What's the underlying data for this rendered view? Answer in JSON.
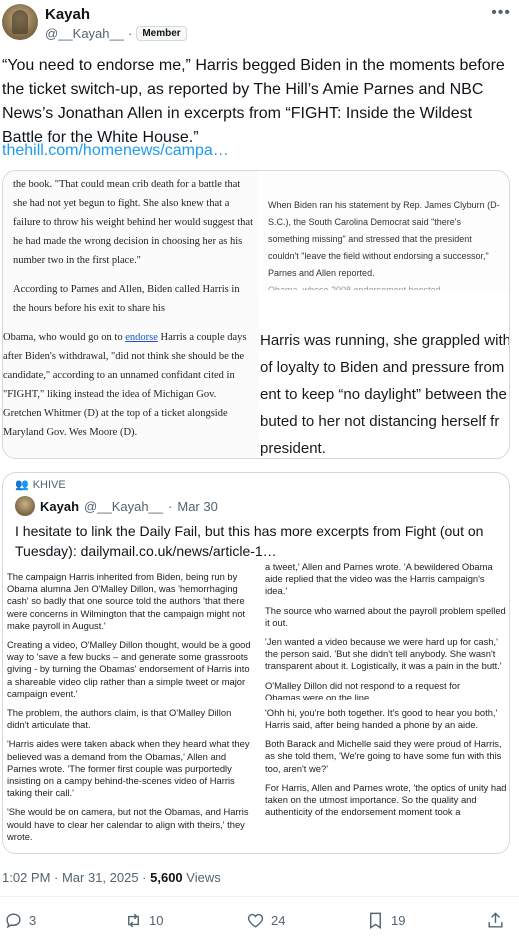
{
  "author": {
    "name": "Kayah",
    "handle": "@__Kayah__",
    "separator": "·",
    "badge": "Member"
  },
  "tweet": {
    "text": "“You need to endorse me,” Harris begged Biden in the moments before the ticket switch-up, as reported by The Hill’s Amie Parnes and NBC News’s Jonathan Allen in excerpts from “FIGHT: Inside the Wildest Battle for the White House.”",
    "link": "thehill.com/homenews/campa…"
  },
  "media1": {
    "left_paragraphs": [
      "the book. \"That could mean crib death for a battle that she had not yet begun to fight. She also knew that a failure to throw his weight behind her would suggest that he had made the wrong decision in choosing her as his number two in the first place.\"",
      "According to Parnes and Allen, Biden called Harris in the hours before his exit to share his"
    ],
    "left_cont_before": "Obama, who would go on to ",
    "left_cont_link": "endorse",
    "left_cont_after": " Harris a couple days after Biden's withdrawal, \"did not think she should be the candidate,\" according to an unnamed confidant cited in \"FIGHT,\" liking instead the idea of Michigan Gov. Gretchen Whitmer (D) at the top of a ticket alongside Maryland Gov. Wes Moore (D).",
    "right_paragraph": "When Biden ran his statement by Rep. James Clyburn (D-S.C.), the South Carolina Democrat said \"there's something missing\" and stressed that the president couldn't \"leave the field without endorsing a successor,\" Parnes and Allen reported.",
    "right_cut": "Obama, whose 2008 endorsement boosted",
    "big_lines": [
      "Harris was running, she grappled with",
      "of loyalty to Biden and pressure from",
      "ent to keep “no daylight” between the",
      "buted to her not distancing herself fr",
      "president."
    ]
  },
  "quote": {
    "community": "KHIVE",
    "name": "Kayah",
    "handle": "@__Kayah__",
    "separator": "·",
    "date": "Mar 30",
    "text": "I hesitate to link the Daily Fail, but this has more excerpts from Fight (out on Tuesday): dailymail.co.uk/news/article-1…"
  },
  "media2": {
    "left": [
      "The campaign Harris inherited from Biden, being run by Obama alumna Jen O'Malley Dillon, was 'hemorrhaging cash' so badly that one source told the authors 'that there were concerns in Wilmington that the campaign might not make payroll in August.'",
      "Creating a video, O'Malley Dillon thought, would be a good way to 'save a few bucks – and generate some grassroots giving - by turning the Obamas' endorsement of Harris into a shareable video clip rather than a simple tweet or major campaign event.'",
      "The problem, the authors claim, is that O'Malley Dillon didn't articulate that.",
      "'Harris aides were taken aback when they heard what they believed was a demand from the Obamas,' Allen and Parnes wrote. 'The former first couple was purportedly insisting on a campy behind-the-scenes video of Harris taking their call.'",
      "'She would be on camera, but not the Obamas, and Harris would have to clear her calendar to align with theirs,' they wrote."
    ],
    "right": [
      "a tweet,' Allen and Parnes wrote. 'A bewildered Obama aide replied that the video was the Harris campaign's idea.'",
      "The source who warned about the payroll problem spelled it out.",
      "'Jen wanted a video because we were hard up for cash,' the person said. 'But she didn't tell anybody. She wasn't transparent about it. Logistically, it was a pain in the butt.'",
      "O'Malley Dillon did not respond to a request for",
      "'Ohh hi, you're both together. It's good to hear you both,' Harris said, after being handed a phone by an aide.",
      "Both Barack and Michelle said they were proud of Harris, as she told them, 'We're going to have some fun with this too, aren't we?'",
      "For Harris, Allen and Parnes wrote, 'the optics of unity had taken on the utmost importance. So the quality and authenticity of the endorsement moment took a"
    ],
    "right_cut": "Obamas were on the line."
  },
  "meta": {
    "time": "1:02 PM · Mar 31, 2025 · ",
    "views_count": "5,600",
    "views_label": " Views"
  },
  "actions": {
    "replies": "3",
    "reposts": "10",
    "likes": "24",
    "bookmarks": "19"
  }
}
